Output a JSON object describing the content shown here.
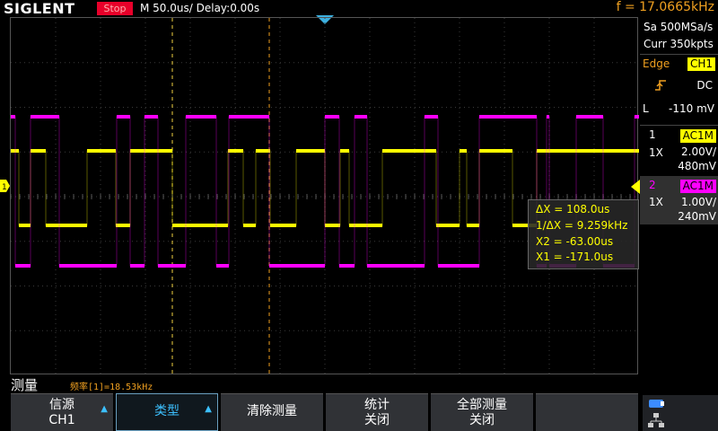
{
  "header": {
    "brand": "SIGLENT",
    "run_state": "Stop",
    "timebase": "M 50.0us/",
    "delay": "Delay:0.00s",
    "frequency": "f = 17.0665kHz"
  },
  "acquisition": {
    "sample_rate": "Sa 500MSa/s",
    "memory": "Curr 350kpts"
  },
  "trigger": {
    "type": "Edge",
    "source": "CH1",
    "coupling": "DC",
    "level_label": "L",
    "level": "-110 mV"
  },
  "channels": [
    {
      "number": "1",
      "coupling": "AC1M",
      "probe": "1X",
      "scale": "2.00V/",
      "offset": "480mV",
      "color": "#ffff00"
    },
    {
      "number": "2",
      "coupling": "AC1M",
      "probe": "1X",
      "scale": "1.00V/",
      "offset": "240mV",
      "color": "#ff00ff"
    }
  ],
  "cursors": {
    "delta_x": "ΔX = 108.0us",
    "inv_delta_x": "1/ΔX = 9.259kHz",
    "x2": "X2 = -63.00us",
    "x1": "X1 = -171.0us"
  },
  "ground_marker": "1",
  "measure": {
    "title": "测量",
    "value": "频率[1]=18.53kHz"
  },
  "softkeys": [
    {
      "line1": "信源",
      "line2": "CH1"
    },
    {
      "line1": "类型",
      "line2": ""
    },
    {
      "line1": "清除测量",
      "line2": ""
    },
    {
      "line1": "统计",
      "line2": "关闭"
    },
    {
      "line1": "全部测量",
      "line2": "关闭"
    }
  ],
  "icons": {
    "trigger_slope": "rising-edge-icon",
    "usb": "usb-icon",
    "network": "network-icon"
  }
}
